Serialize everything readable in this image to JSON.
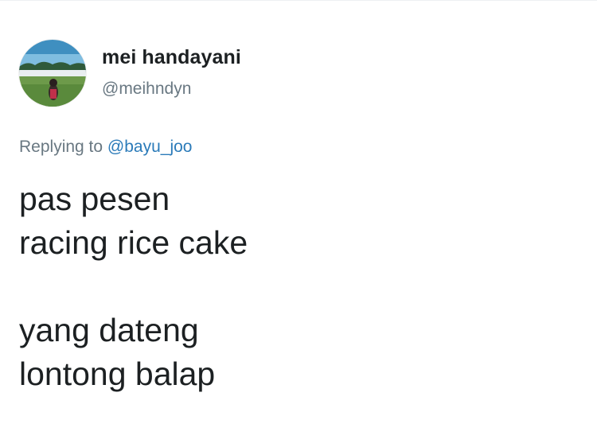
{
  "tweet": {
    "author": {
      "display_name": "mei handayani",
      "handle": "@meihndyn",
      "avatar": "profile-photo"
    },
    "reply_context": {
      "prefix": "Replying to",
      "mention": "@bayu_joo"
    },
    "text_lines": [
      "pas pesen",
      "racing rice cake",
      "",
      "yang dateng",
      "lontong balap"
    ]
  },
  "colors": {
    "text_primary": "#1c2022",
    "text_secondary": "#697882",
    "link": "#2b7bb9",
    "background": "#ffffff"
  }
}
